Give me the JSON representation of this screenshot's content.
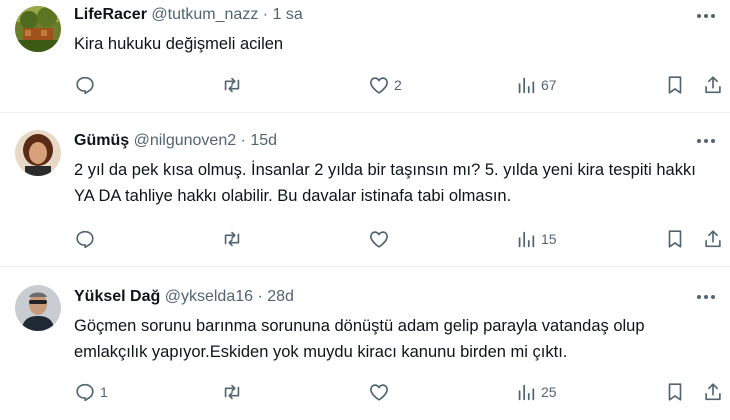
{
  "tweets": [
    {
      "name": "LifeRacer",
      "handle": "@tutkum_nazz",
      "separator": "·",
      "time": "1 sa",
      "text": "Kira hukuku değişmeli acilen",
      "replies": "",
      "retweets": "",
      "likes": "2",
      "views": "67"
    },
    {
      "name": "Gümüş",
      "handle": "@nilgunoven2",
      "separator": "·",
      "time": "15d",
      "text": "2 yıl da pek kısa olmuş.  İnsanlar 2 yılda bir taşınsın mı? 5. yılda yeni kira tespiti hakkı YA DA tahliye hakkı olabilir. Bu davalar istinafa tabi olmasın.",
      "replies": "",
      "retweets": "",
      "likes": "",
      "views": "15"
    },
    {
      "name": "Yüksel Dağ",
      "handle": "@ykselda16",
      "separator": "·",
      "time": "28d",
      "text": "Göçmen sorunu barınma sorununa dönüştü adam gelip parayla vatandaş olup emlakçılık yapıyor.Eskiden yok muydu kiracı kanunu birden mi çıktı.",
      "replies": "1",
      "retweets": "",
      "likes": "",
      "views": "25"
    }
  ],
  "icons": {
    "reply": "reply-icon",
    "retweet": "retweet-icon",
    "like": "heart-icon",
    "views": "views-chart-icon",
    "bookmark": "bookmark-icon",
    "share": "share-icon",
    "more": "more-dots-icon"
  },
  "colors": {
    "text": "#0f1419",
    "secondary": "#536471",
    "divider": "#eff3f4"
  }
}
